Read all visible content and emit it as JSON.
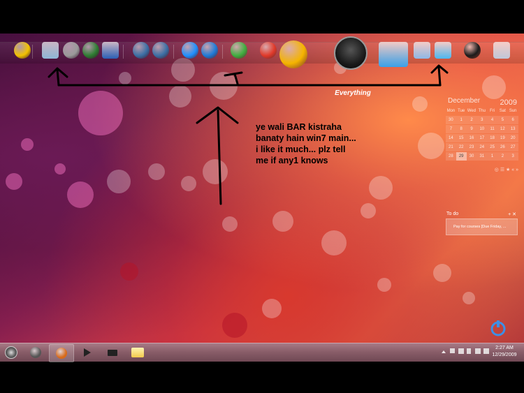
{
  "dock": {
    "label": "Everything",
    "icons": [
      {
        "name": "biohazard-icon",
        "color": "#f2c200"
      },
      {
        "name": "virtualbox-icon",
        "color": "#8fb6d6"
      },
      {
        "name": "moon-icon",
        "color": "#9a9a9a"
      },
      {
        "name": "utorrent-icon",
        "color": "#2e7d32"
      },
      {
        "name": "word-icon",
        "color": "#2b5fb5"
      },
      {
        "name": "dreamweaver-icon",
        "color": "#3b6fa5"
      },
      {
        "name": "fireworks-icon",
        "color": "#3b6fa5"
      },
      {
        "name": "firefox-icon",
        "color": "#1e90ff"
      },
      {
        "name": "internet-explorer-icon",
        "color": "#1e7bd8"
      },
      {
        "name": "messenger-icon",
        "color": "#3fae3f"
      },
      {
        "name": "ccleaner-icon",
        "color": "#e03a2a"
      },
      {
        "name": "honeycomb-icon",
        "color": "#f5b400"
      },
      {
        "name": "search-everything-icon",
        "color": "#222222"
      },
      {
        "name": "computer-icon",
        "color": "#3aa0e8"
      },
      {
        "name": "folder-icon",
        "color": "#8fb8e6"
      },
      {
        "name": "control-panel-icon",
        "color": "#4db8f0"
      },
      {
        "name": "globe-icon",
        "color": "#1b1b1b"
      },
      {
        "name": "database-icon",
        "color": "#c0c8d8"
      }
    ]
  },
  "annotation": {
    "lines": [
      "ye wali BAR kistraha",
      "banaty hain win7 main...",
      "i like it much... plz tell",
      "me if any1 knows"
    ]
  },
  "calendar": {
    "month": "December",
    "year": "2009",
    "weekdays": [
      "Mon",
      "Tue",
      "Wed",
      "Thu",
      "Fri",
      "Sat",
      "Sun"
    ],
    "weeks": [
      [
        "30",
        "1",
        "2",
        "3",
        "4",
        "5",
        "6"
      ],
      [
        "7",
        "8",
        "9",
        "10",
        "11",
        "12",
        "13"
      ],
      [
        "14",
        "15",
        "16",
        "17",
        "18",
        "19",
        "20"
      ],
      [
        "21",
        "22",
        "23",
        "24",
        "25",
        "26",
        "27"
      ],
      [
        "28",
        "29",
        "30",
        "31",
        "1",
        "2",
        "3"
      ]
    ],
    "today": "29",
    "footer": "◎ ☰ ★ « »"
  },
  "todo": {
    "title": "To do",
    "add": "+ ✕",
    "item": "Pay for courses [Due Friday, ..."
  },
  "taskbar": {
    "buttons": [
      {
        "name": "start-orb-icon"
      },
      {
        "name": "users-icon"
      },
      {
        "name": "firefox-taskbar-icon"
      },
      {
        "name": "media-player-icon"
      },
      {
        "name": "mail-icon"
      },
      {
        "name": "explorer-folder-icon"
      }
    ],
    "tray_icons": [
      "up-arrow-icon",
      "flag-icon",
      "network-icon",
      "signal-icon",
      "battery-icon",
      "volume-icon"
    ],
    "clock_time": "2:27 AM",
    "clock_date": "12/29/2009"
  }
}
